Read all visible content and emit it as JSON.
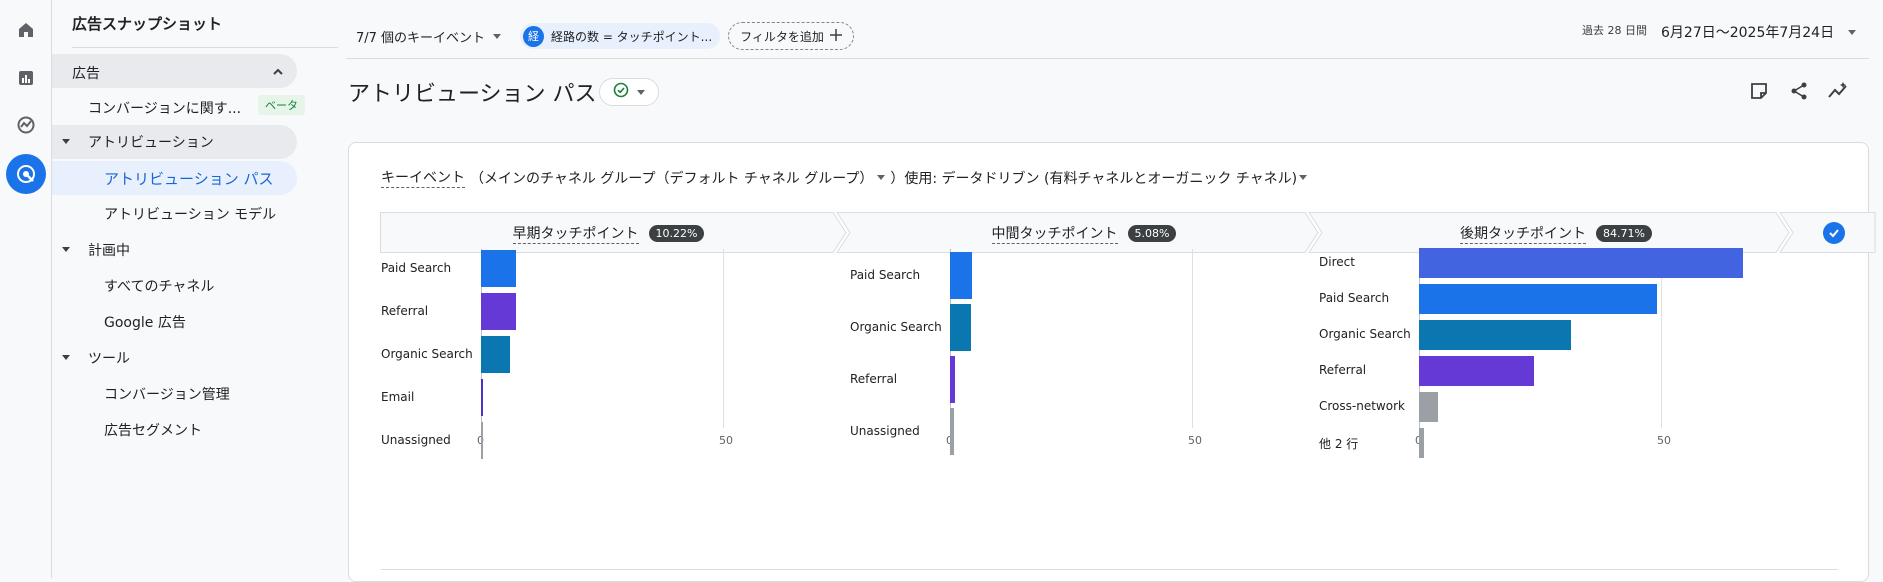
{
  "nav": {
    "title": "広告スナップショット",
    "section_label": "広告",
    "items": [
      {
        "label": "コンバージョンに関す..."
      },
      {
        "label": "アトリビューション"
      },
      {
        "label": "アトリビューション パス"
      },
      {
        "label": "アトリビューション モデル"
      },
      {
        "label": "計画中"
      },
      {
        "label": "すべてのチャネル"
      },
      {
        "label": "Google 広告"
      },
      {
        "label": "ツール"
      },
      {
        "label": "コンバージョン管理"
      },
      {
        "label": "広告セグメント"
      }
    ],
    "beta_label": "ベータ"
  },
  "topbar": {
    "key_events": "7/7 個のキーイベント",
    "filter_badge": "経",
    "filter_chip": "経路の数 = タッチポイント...",
    "add_filter": "フィルタを追加",
    "date_prefix": "過去 28 日間",
    "date_range": "6月27日～2025年7月24日"
  },
  "page": {
    "title": "アトリビューション パス"
  },
  "card": {
    "metric_link": "キーイベント",
    "description_1": "（メインのチャネル グループ（デフォルト チャネル グループ）",
    "description_2": "）使用: データドリブン (有料チャネルとオーガニック チャネル)",
    "stages": [
      {
        "label": "早期タッチポイント",
        "pct": "10.22%"
      },
      {
        "label": "中間タッチポイント",
        "pct": "5.08%"
      },
      {
        "label": "後期タッチポイント",
        "pct": "84.71%"
      }
    ]
  },
  "colors": {
    "blue": "#1a73e8",
    "royal": "#4364e1",
    "purple": "#6439d6",
    "teal": "#0b77b0",
    "indigo": "#4b33c9",
    "gray": "#9aa0a6"
  },
  "chart_data": [
    {
      "type": "bar",
      "orientation": "horizontal",
      "categories": [
        "Paid Search",
        "Referral",
        "Organic Search",
        "Email",
        "Unassigned"
      ],
      "values": [
        7.3,
        7.2,
        6,
        0.4,
        0.2
      ],
      "colors": [
        "#1a73e8",
        "#6439d6",
        "#0b77b0",
        "#4b33c9",
        "#9aa0a6"
      ],
      "xticks": [
        "0",
        "50"
      ],
      "xlim": [
        0,
        50
      ]
    },
    {
      "type": "bar",
      "orientation": "horizontal",
      "categories": [
        "Paid Search",
        "Organic Search",
        "Referral",
        "Unassigned"
      ],
      "values": [
        4.5,
        4.3,
        1,
        0.8
      ],
      "colors": [
        "#1a73e8",
        "#0b77b0",
        "#6439d6",
        "#9aa0a6"
      ],
      "xticks": [
        "0",
        "50"
      ],
      "xlim": [
        0,
        50
      ]
    },
    {
      "type": "bar",
      "orientation": "horizontal",
      "categories": [
        "Direct",
        "Paid Search",
        "Organic Search",
        "Referral",
        "Cross-network",
        "他 2 行"
      ],
      "values": [
        67,
        49.2,
        31.5,
        23.8,
        4,
        1
      ],
      "colors": [
        "#4364e1",
        "#1a73e8",
        "#0b77b0",
        "#6439d6",
        "#9aa0a6",
        "#9aa0a6"
      ],
      "xticks": [
        "0",
        "50"
      ],
      "xlim": [
        0,
        50
      ]
    }
  ]
}
